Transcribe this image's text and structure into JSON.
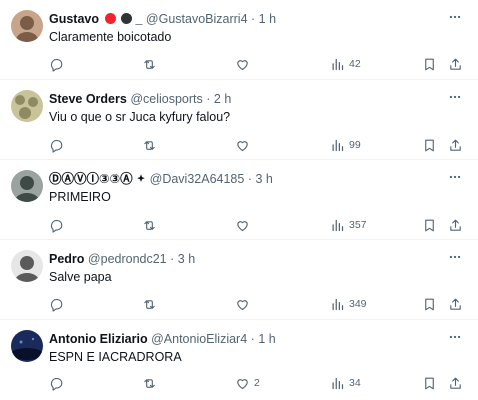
{
  "posts": [
    {
      "name": "Gustavo",
      "name_suffix": "_",
      "handle": "@GustavoBizarri4",
      "separator": "·",
      "time": "1 h",
      "text": "Claramente boicotado",
      "likes": "",
      "views": "42",
      "avatar_colors": [
        "#c8a58a",
        "#7a5c48"
      ]
    },
    {
      "name": "Steve Orders",
      "handle": "@celiosports",
      "separator": "·",
      "time": "2 h",
      "text": "Viu o que o sr Juca kyfury falou?",
      "likes": "",
      "views": "99",
      "avatar_colors": [
        "#c9c39a",
        "#8f8a62"
      ]
    },
    {
      "name": "ⒹⒶⓋⒾ③③Ⓐ",
      "handle": "@Davi32A64185",
      "separator": "·",
      "time": "3 h",
      "text": "PRIMEIRO",
      "likes": "",
      "views": "357",
      "avatar_colors": [
        "#9aa3a0",
        "#3e4a46"
      ]
    },
    {
      "name": "Pedro",
      "handle": "@pedrondc21",
      "separator": "·",
      "time": "3 h",
      "text": "Salve papa",
      "likes": "",
      "views": "349",
      "avatar_colors": [
        "#e6e6e6",
        "#5a5a5a"
      ]
    },
    {
      "name": "Antonio Eliziario",
      "handle": "@AntonioEliziar4",
      "separator": "·",
      "time": "1 h",
      "text": "ESPN E IACRADRORA",
      "likes": "2",
      "views": "34",
      "avatar_colors": [
        "#1a2a5a",
        "#08102a"
      ]
    }
  ],
  "icons": {
    "reply": "reply-icon",
    "repost": "repost-icon",
    "like": "like-icon",
    "views": "views-icon",
    "bookmark": "bookmark-icon",
    "share": "share-icon",
    "more": "more-icon"
  },
  "colors": {
    "text": "#0f1419",
    "secondary": "#536471",
    "divider": "#eff3f4",
    "red_badge": "#f4212e",
    "dark_badge": "#2f3336"
  }
}
